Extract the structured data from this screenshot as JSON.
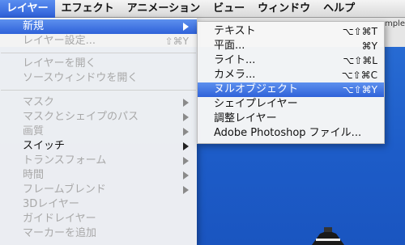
{
  "menubar": {
    "items": [
      "レイヤー",
      "エフェクト",
      "アニメーション",
      "ビュー",
      "ウィンドウ",
      "ヘルプ"
    ]
  },
  "background": {
    "fragment": "mple"
  },
  "layer_menu": {
    "items": [
      {
        "label": "新規",
        "state": "highlighted",
        "submenu": true
      },
      {
        "label": "レイヤー設定...",
        "shortcut": "⇧⌘Y",
        "state": "disabled"
      },
      {
        "label": "レイヤーを開く",
        "state": "disabled"
      },
      {
        "label": "ソースウィンドウを開く",
        "state": "disabled"
      },
      {
        "label": "マスク",
        "state": "disabled",
        "submenu": true
      },
      {
        "label": "マスクとシェイプのパス",
        "state": "disabled",
        "submenu": true
      },
      {
        "label": "画質",
        "state": "disabled",
        "submenu": true
      },
      {
        "label": "スイッチ",
        "state": "enabled",
        "submenu": true
      },
      {
        "label": "トランスフォーム",
        "state": "disabled",
        "submenu": true
      },
      {
        "label": "時間",
        "state": "disabled",
        "submenu": true
      },
      {
        "label": "フレームブレンド",
        "state": "disabled",
        "submenu": true
      },
      {
        "label": "3Dレイヤー",
        "state": "disabled"
      },
      {
        "label": "ガイドレイヤー",
        "state": "disabled"
      },
      {
        "label": "マーカーを追加",
        "state": "disabled"
      }
    ]
  },
  "new_submenu": {
    "items": [
      {
        "label": "テキスト",
        "shortcut": "⌥⇧⌘T"
      },
      {
        "label": "平面...",
        "shortcut": "⌘Y"
      },
      {
        "label": "ライト...",
        "shortcut": "⌥⇧⌘L"
      },
      {
        "label": "カメラ...",
        "shortcut": "⌥⇧⌘C"
      },
      {
        "label": "ヌルオブジェクト",
        "shortcut": "⌥⇧⌘Y",
        "state": "highlighted"
      },
      {
        "label": "シェイプレイヤー",
        "shortcut": ""
      },
      {
        "label": "調整レイヤー",
        "shortcut": ""
      },
      {
        "label": "Adobe Photoshop ファイル...",
        "shortcut": ""
      }
    ]
  },
  "colors": {
    "highlight": "#2f62d9",
    "disabled_text": "#a8a8a8",
    "background_blue": "#1d5cc8"
  }
}
